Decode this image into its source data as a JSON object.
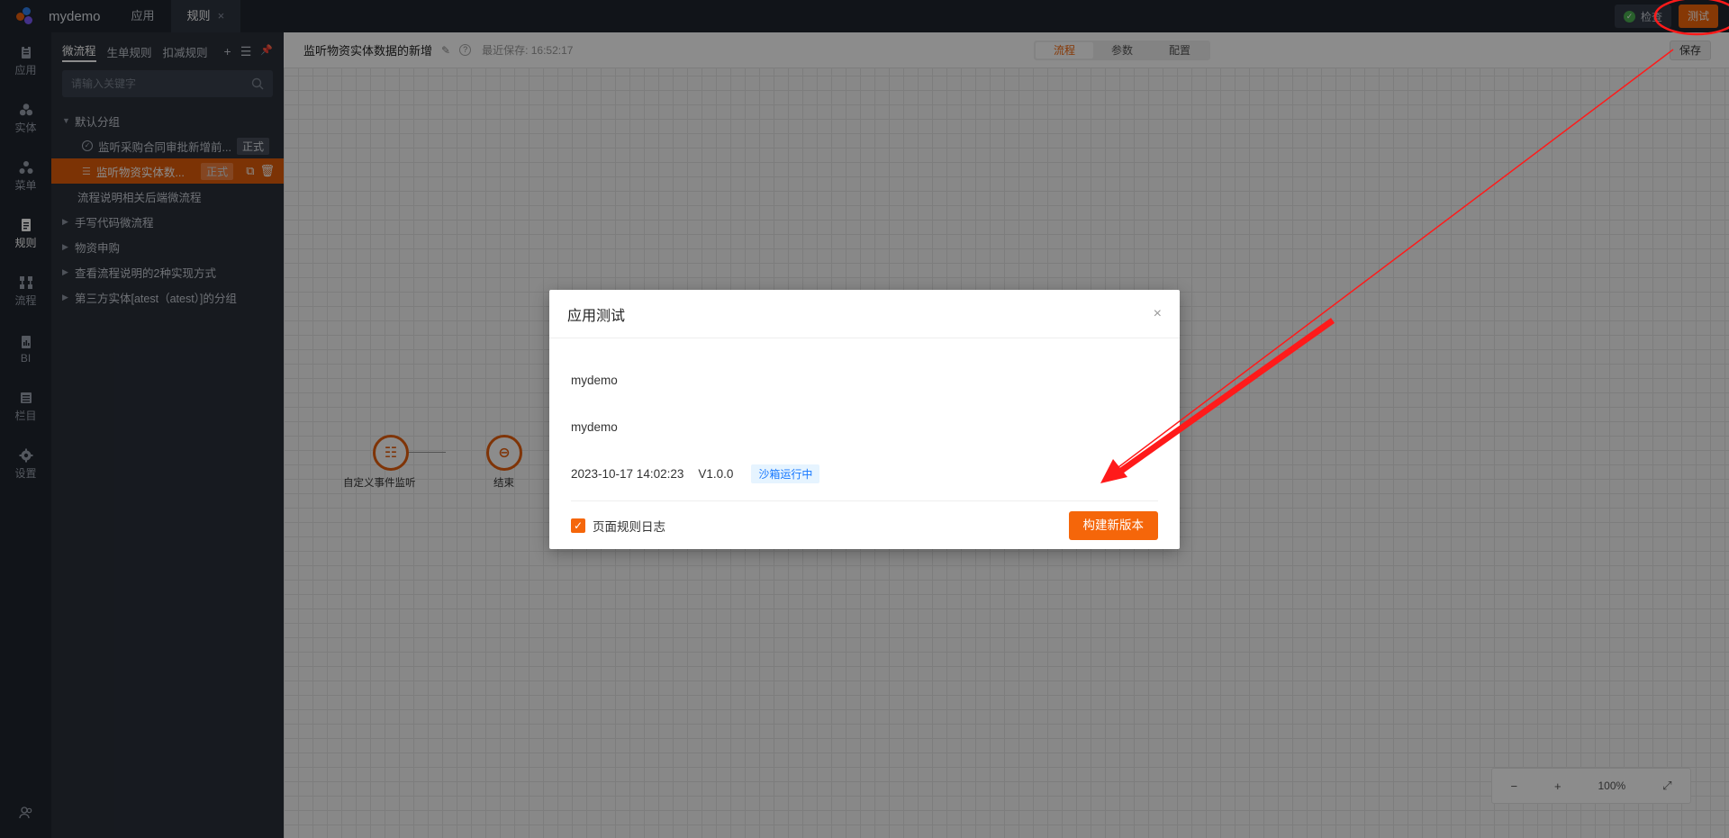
{
  "app": {
    "name": "mydemo"
  },
  "topbar": {
    "tabs": [
      {
        "label": "应用"
      },
      {
        "label": "规则",
        "close": "×"
      }
    ],
    "check_label": "检查",
    "check_mark": "✓",
    "test_label": "测试"
  },
  "rail": {
    "items": [
      {
        "label": "应用",
        "icon": "clipboard-icon"
      },
      {
        "label": "实体",
        "icon": "cubes-icon"
      },
      {
        "label": "菜单",
        "icon": "nodes-icon"
      },
      {
        "label": "规则",
        "icon": "document-icon"
      },
      {
        "label": "流程",
        "icon": "flow-icon"
      },
      {
        "label": "BI",
        "icon": "report-icon"
      },
      {
        "label": "栏目",
        "icon": "list-icon"
      },
      {
        "label": "设置",
        "icon": "gear-icon"
      }
    ],
    "bottom_icon": "users-icon"
  },
  "panel": {
    "tabs": [
      {
        "label": "微流程"
      },
      {
        "label": "生单规则"
      },
      {
        "label": "扣减规则"
      }
    ],
    "tools": [
      "+",
      "☰",
      "📌"
    ],
    "search_placeholder": "请输入关键字",
    "group_default": "默认分组",
    "leaf1": {
      "label": "监听采购合同审批新增前...",
      "tag": "正式"
    },
    "leaf2": {
      "label": "监听物资实体数...",
      "tag": "正式"
    },
    "flat1": "流程说明相关后端微流程",
    "groups": [
      {
        "label": "手写代码微流程"
      },
      {
        "label": "物资申购"
      },
      {
        "label": "查看流程说明的2种实现方式"
      },
      {
        "label": "第三方实体[atest（atest）]的分组"
      }
    ]
  },
  "main": {
    "title": "监听物资实体数据的新增",
    "saved_label": "最近保存: 16:52:17",
    "segments": [
      {
        "label": "流程"
      },
      {
        "label": "参数"
      },
      {
        "label": "配置"
      }
    ],
    "save_label": "保存",
    "nodes": [
      {
        "label": "自定义事件监听"
      },
      {
        "label": "结束"
      }
    ],
    "zoom": {
      "minus": "−",
      "plus": "+",
      "level": "100%",
      "fullscreen": "⤢"
    }
  },
  "modal": {
    "title": "应用测试",
    "close": "×",
    "row1": "mydemo",
    "row2": "mydemo",
    "datetime": "2023-10-17 14:02:23",
    "version": "V1.0.0",
    "status": "沙箱运行中",
    "checkbox_mark": "✓",
    "checkbox_label": "页面规则日志",
    "build_label": "构建新版本"
  },
  "colors": {
    "accent": "#f5660a",
    "annotation": "#ff1a1a"
  }
}
